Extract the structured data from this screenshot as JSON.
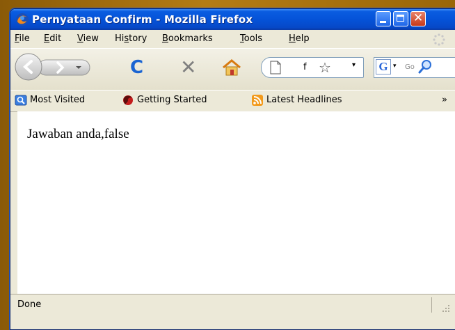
{
  "window": {
    "title": "Pernyataan Confirm - Mozilla Firefox",
    "title_bar_color": "#0553d8",
    "close_button_color": "#c7391a",
    "min_icon": "minimize-icon",
    "max_icon": "maximize-icon",
    "close_icon": "close-icon"
  },
  "menu": {
    "items": [
      {
        "label": "File",
        "mnemonic": "F",
        "rest": "ile"
      },
      {
        "label": "Edit",
        "mnemonic": "E",
        "rest": "dit"
      },
      {
        "label": "View",
        "mnemonic": "V",
        "rest": "iew"
      },
      {
        "label": "History",
        "pre": "Hi",
        "mnemonic": "s",
        "rest": "tory"
      },
      {
        "label": "Bookmarks",
        "mnemonic": "B",
        "rest": "ookmarks"
      },
      {
        "label": "Tools",
        "mnemonic": "T",
        "rest": "ools"
      },
      {
        "label": "Help",
        "mnemonic": "H",
        "rest": "elp"
      }
    ]
  },
  "navigation": {
    "back_icon": "back-arrow-icon",
    "forward_icon": "forward-arrow-icon",
    "reload_glyph": "C",
    "stop_glyph": "✕",
    "url_value": "f",
    "star_glyph": "☆",
    "dropdown_glyph": "▾",
    "search_engine_letter": "G",
    "search_placeholder": "Go"
  },
  "bookmarks": {
    "items": [
      {
        "label": "Most Visited",
        "icon": "most-visited-icon"
      },
      {
        "label": "Getting Started",
        "icon": "firefox-icon"
      },
      {
        "label": "Latest Headlines",
        "icon": "rss-feed-icon"
      }
    ],
    "overflow": "»"
  },
  "page": {
    "text": "Jawaban anda,false"
  },
  "status": {
    "text": "Done"
  }
}
